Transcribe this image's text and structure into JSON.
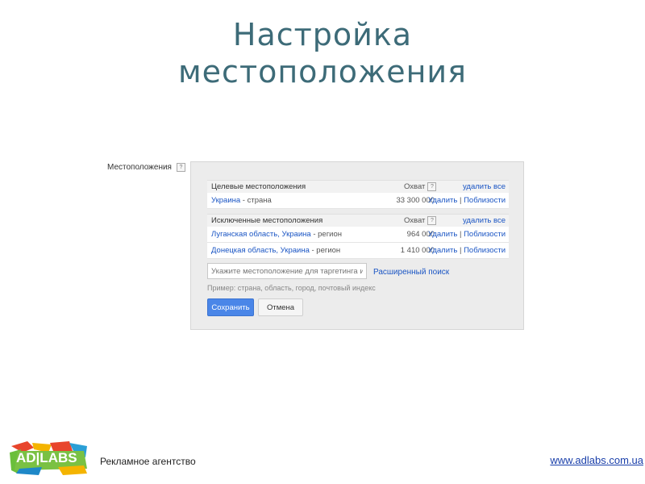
{
  "slide": {
    "title_line1": "Настройка",
    "title_line2": "местоположения"
  },
  "locations": {
    "label": "Местоположения",
    "help": "?",
    "targeted": {
      "header_name": "Целевые местоположения",
      "header_reach": "Охват",
      "header_remove_all": "удалить все",
      "rows": [
        {
          "name": "Украина",
          "type": " - страна",
          "reach": "33 300 000",
          "remove": "Удалить",
          "sep": " | ",
          "nearby": "Поблизости"
        }
      ]
    },
    "excluded": {
      "header_name": "Исключенные местоположения",
      "header_reach": "Охват",
      "header_remove_all": "удалить все",
      "rows": [
        {
          "name": "Луганская область, Украина",
          "type": " - регион",
          "reach": "964 000",
          "remove": "Удалить",
          "sep": " | ",
          "nearby": "Поблизости"
        },
        {
          "name": "Донецкая область, Украина",
          "type": " - регион",
          "reach": "1 410 000",
          "remove": "Удалить",
          "sep": " | ",
          "nearby": "Поблизости"
        }
      ]
    },
    "search": {
      "placeholder": "Укажите местоположение для таргетинга или",
      "advanced_link": "Расширенный поиск",
      "example": "Пример: страна, область, город, почтовый индекс"
    },
    "save_label": "Сохранить",
    "cancel_label": "Отмена"
  },
  "footer": {
    "logo_text": "AD|LABS",
    "agency": "Рекламное агентство",
    "site": "www.adlabs.com.ua"
  },
  "colors": {
    "title": "#3d6b78",
    "link": "#1a55c4",
    "save_button": "#4a86e8"
  }
}
